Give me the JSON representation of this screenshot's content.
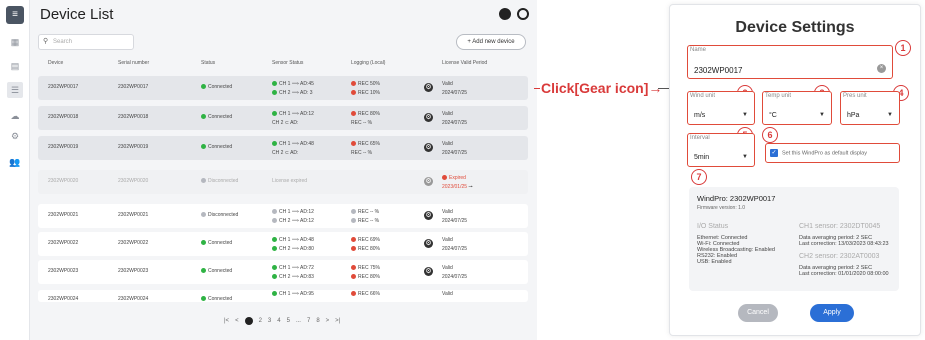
{
  "list": {
    "title": "Device List",
    "search_placeholder": "Search",
    "add_label": "+ Add new device",
    "columns": [
      "Device",
      "Serial number",
      "Status",
      "Sensor Status",
      "Logging (Local)",
      "License Valid Period"
    ],
    "rows": [
      {
        "device": "2302WP0017",
        "serial": "2302WP0017",
        "status": "Connected",
        "ch1": "CH 1 ⟹ AD:45",
        "ch2": "CH 2 ⟹ AD: 3",
        "log1": "REC 50%",
        "log2": "REC 10%",
        "lic1": "Valid",
        "lic2": "2024/07/25"
      },
      {
        "device": "2302WP0018",
        "serial": "2302WP0018",
        "status": "Connected",
        "ch1": "CH 1 ⟹ AD:12",
        "ch2": "CH 2 ⊂ AD:",
        "log1": "REC 80%",
        "log2": "REC -- %",
        "lic1": "Valid",
        "lic2": "2024/07/25"
      },
      {
        "device": "2302WP0019",
        "serial": "2302WP0019",
        "status": "Connected",
        "ch1": "CH 1 ⟹ AD:48",
        "ch2": "CH 2 ⊂ AD:",
        "log1": "REC 65%",
        "log2": "REC -- %",
        "lic1": "Valid",
        "lic2": "2024/07/25"
      },
      {
        "device": "2302WP0020",
        "serial": "2302WP0020",
        "status": "Disconnected",
        "ch1": "License expired",
        "ch2": "",
        "log1": "",
        "log2": "",
        "lic1": "Expired",
        "lic2": "2023/01/25"
      },
      {
        "device": "2302WP0021",
        "serial": "2302WP0021",
        "status": "Disconnected",
        "ch1": "CH 1 ⟹ AD:12",
        "ch2": "CH 2 ⟹ AD:12",
        "log1": "REC -- %",
        "log2": "REC -- %",
        "lic1": "Valid",
        "lic2": "2024/07/25"
      },
      {
        "device": "2302WP0022",
        "serial": "2302WP0022",
        "status": "Connected",
        "ch1": "CH 1 ⟹ AD:48",
        "ch2": "CH 2 ⟹ AD:80",
        "log1": "REC 69%",
        "log2": "REC 80%",
        "lic1": "Valid",
        "lic2": "2024/07/25"
      },
      {
        "device": "2302WP0023",
        "serial": "2302WP0023",
        "status": "Connected",
        "ch1": "CH 1 ⟹ AD:72",
        "ch2": "CH 2 ⟹ AD:83",
        "log1": "REC 75%",
        "log2": "REC 80%",
        "lic1": "Valid",
        "lic2": "2024/07/25"
      },
      {
        "device": "2302WP0024",
        "serial": "2302WP0024",
        "status": "Connected",
        "ch1": "CH 1 ⟹ AD:95",
        "ch2": "",
        "log1": "REC 66%",
        "log2": "",
        "lic1": "Valid",
        "lic2": ""
      }
    ],
    "pager": [
      "|<",
      "<",
      "1",
      "2",
      "3",
      "4",
      "5",
      "...",
      "7",
      "8",
      ">",
      ">|"
    ]
  },
  "callout": {
    "label": "Click[Gear icon]→"
  },
  "modal": {
    "title": "Device Settings",
    "name_label": "Name",
    "name_value": "2302WP0017",
    "wind_label": "Wind unit",
    "wind_value": "m/s",
    "temp_label": "Temp unit",
    "temp_value": "°C",
    "pres_label": "Pres unit",
    "pres_value": "hPa",
    "interval_label": "Interval",
    "interval_value": "5min",
    "default_label": "Set this WindPro as default display",
    "numbers": [
      "1",
      "2",
      "3",
      "4",
      "5",
      "6",
      "7"
    ],
    "info": {
      "title": "WindPro: 2302WP0017",
      "fw": "Firmware version: 1.0",
      "io_title": "I/O Status",
      "io": [
        "Ethernet: Connected",
        "Wi-Fi: Connected",
        "Wireless Broadcasting: Enabled",
        "RS232: Enabled",
        "USB: Enabled"
      ],
      "ch1_title": "CH1 sensor: 2302DT0045",
      "ch1": [
        "Data averaging period: 2 SEC",
        "Last correction: 13/03/2023 08:43:23"
      ],
      "ch2_title": "CH2 sensor: 2302AT0003",
      "ch2": [
        "Data averaging period: 2 SEC",
        "Last correction: 01/01/2020 08:00:00"
      ]
    },
    "cancel": "Cancel",
    "apply": "Apply"
  },
  "colors": {
    "accent": "#2b6fd6",
    "callout": "#d93a3a",
    "connected": "#2fb344",
    "rec": "#e04b3a"
  }
}
